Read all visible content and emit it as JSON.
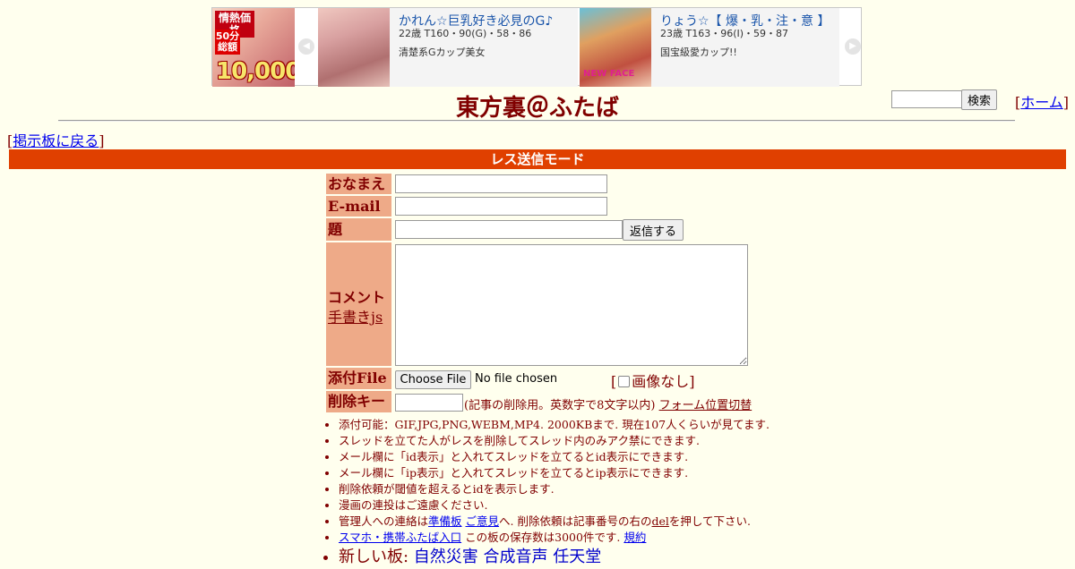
{
  "ad": {
    "side": {
      "hot_label": "情熱価格",
      "fifty_label": "50分総額",
      "price_label": "10,000"
    },
    "cards": [
      {
        "name": "かれん☆巨乳好き必見のG♪",
        "meta": "22歳 T160・90(G)・58・86",
        "desc": "清楚系Gカップ美女"
      },
      {
        "name": "りょう☆【 爆・乳・注・意 】",
        "meta": "23歳 T163・96(I)・59・87",
        "desc": "国宝級愛カップ!!",
        "badge": "NEW FACE"
      }
    ]
  },
  "header": {
    "title": "東方裏＠ふたば",
    "search_button": "検索",
    "home_link": "ホーム",
    "back_link": "掲示板に戻る"
  },
  "mode_label": "レス送信モード",
  "form": {
    "name_label": "おなまえ",
    "email_label": "E-mail",
    "subject_label": "題名",
    "reply_button": "返信する",
    "comment_label": "コメント",
    "handwrite_link": "手書きjs",
    "file_label": "添付File",
    "choose_file_button": "Choose File",
    "file_status": "No file chosen",
    "noimage_label": "画像なし",
    "delkey_label": "削除キー",
    "delkey_note": "(記事の削除用。英数字で8文字以内)",
    "form_position_link": "フォーム位置切替"
  },
  "notes": {
    "upload_info": "添付可能：GIF,JPG,PNG,WEBM,MP4. 2000KBまで. 現在107人くらいが見てます.",
    "thread_owner": "スレッドを立てた人がレスを削除してスレッド内のみアク禁にできます.",
    "id_display": "メール欄に「id表示」と入れてスレッドを立てるとid表示にできます.",
    "ip_display": "メール欄に「ip表示」と入れてスレッドを立てるとip表示にできます.",
    "delete_threshold": "削除依頼が閾値を超えるとidを表示します.",
    "manga_notice": "漫画の連投はご遠慮ください.",
    "admin_prefix": "管理人への連絡は",
    "admin_link1": "準備板",
    "admin_link2": "ご意見",
    "admin_middle": "へ. 削除依頼は記事番号の右の",
    "admin_del": "del",
    "admin_suffix": "を押して下さい.",
    "mobile_link": "スマホ・携帯ふたば入口",
    "retention": " この板の保存数は3000件です.",
    "rules_link": "規約",
    "new_boards_prefix": "新しい板: ",
    "new_boards": [
      "自然災害",
      "合成音声",
      "任天堂"
    ]
  }
}
